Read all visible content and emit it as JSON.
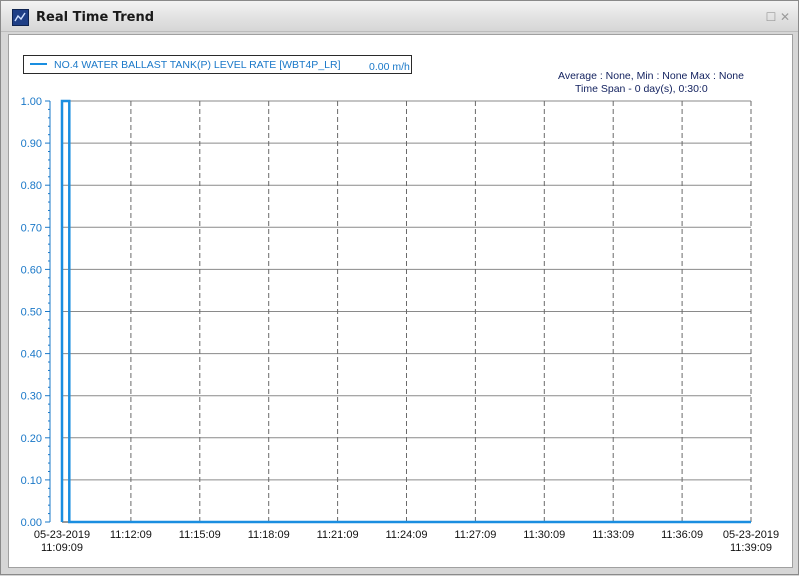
{
  "window": {
    "title": "Real Time Trend",
    "restore_icon": "restore-icon",
    "close_icon": "close-icon"
  },
  "legend": {
    "label": "NO.4 WATER BALLAST TANK(P) LEVEL RATE [WBT4P_LR]",
    "current_value": "0.00 m/h",
    "color": "#1a8ee0"
  },
  "stats": {
    "average_min_max": "Average : None, Min : None Max : None",
    "time_span": "Time Span - 0 day(s),  0:30:0"
  },
  "chart_data": {
    "type": "line",
    "title": "",
    "xlabel": "",
    "ylabel": "",
    "ylim": [
      0,
      1
    ],
    "y_ticks": [
      "0.00",
      "0.10",
      "0.20",
      "0.30",
      "0.40",
      "0.50",
      "0.60",
      "0.70",
      "0.80",
      "0.90",
      "1.00"
    ],
    "x_ticks": [
      [
        "05-23-2019",
        "11:09:09"
      ],
      [
        "11:12:09"
      ],
      [
        "11:15:09"
      ],
      [
        "11:18:09"
      ],
      [
        "11:21:09"
      ],
      [
        "11:24:09"
      ],
      [
        "11:27:09"
      ],
      [
        "11:30:09"
      ],
      [
        "11:33:09"
      ],
      [
        "11:36:09"
      ],
      [
        "05-23-2019",
        "11:39:09"
      ]
    ],
    "grid": true,
    "series": [
      {
        "name": "NO.4 WATER BALLAST TANK(P) LEVEL RATE [WBT4P_LR]",
        "color": "#1a8ee0",
        "x": [
          "11:09:09",
          "11:09:09",
          "11:09:28",
          "11:09:28",
          "11:39:09"
        ],
        "values": [
          0.0,
          1.0,
          1.0,
          0.0,
          0.0
        ]
      }
    ]
  }
}
